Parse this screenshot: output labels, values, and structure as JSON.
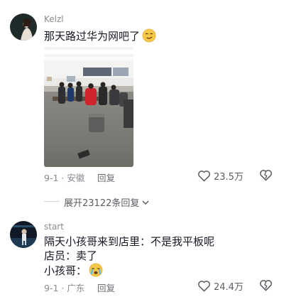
{
  "comments": [
    {
      "username": "Kelzl",
      "text": "那天路过华为网吧了",
      "date": "9-1",
      "location": "安徽",
      "reply_label": "回复",
      "likes": "23.5万",
      "emoji": "smirk-face"
    },
    {
      "username": "start",
      "lines": [
        "隔天小孩哥来到店里：不是我平板呢",
        "店员：卖了",
        "小孩哥："
      ],
      "date": "9-1",
      "location": "广东",
      "reply_label": "回复",
      "likes": "24.4万",
      "emoji": "crying-face"
    }
  ],
  "expand_replies": "展开23122条回复",
  "colors": {
    "text": "#161823",
    "meta": "#8a8b91"
  }
}
